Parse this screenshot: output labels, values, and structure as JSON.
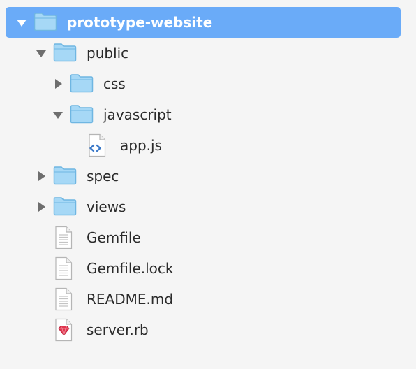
{
  "tree": {
    "root": {
      "label": "prototype-website",
      "icon": "folder-icon",
      "expanded": true,
      "selected": true
    },
    "public": {
      "label": "public",
      "icon": "folder-icon",
      "expanded": true
    },
    "css": {
      "label": "css",
      "icon": "folder-icon",
      "expanded": false
    },
    "javascript": {
      "label": "javascript",
      "icon": "folder-icon",
      "expanded": true
    },
    "app_js": {
      "label": "app.js",
      "icon": "code-file-icon"
    },
    "spec": {
      "label": "spec",
      "icon": "folder-icon",
      "expanded": false
    },
    "views": {
      "label": "views",
      "icon": "folder-icon",
      "expanded": false
    },
    "gemfile": {
      "label": "Gemfile",
      "icon": "text-file-icon"
    },
    "gemfile_lock": {
      "label": "Gemfile.lock",
      "icon": "text-file-icon"
    },
    "readme": {
      "label": "README.md",
      "icon": "text-file-icon"
    },
    "server_rb": {
      "label": "server.rb",
      "icon": "ruby-file-icon"
    }
  },
  "colors": {
    "background": "#f5f5f5",
    "selection": "#6aabf8",
    "folder_fill": "#a6d8f6",
    "folder_stroke": "#6fb6e2",
    "text": "#2b2b2b",
    "ruby": "#e0364f"
  }
}
